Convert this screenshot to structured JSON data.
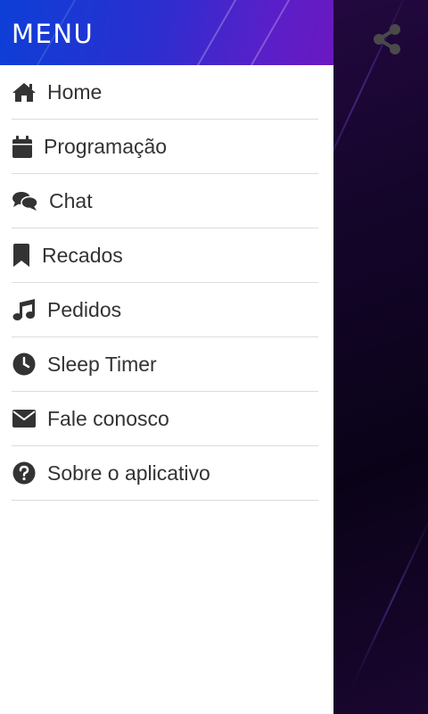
{
  "drawer": {
    "title": "MENU",
    "items": [
      {
        "label": "Home",
        "icon": "home-icon"
      },
      {
        "label": "Programação",
        "icon": "calendar-icon"
      },
      {
        "label": "Chat",
        "icon": "chat-icon"
      },
      {
        "label": "Recados",
        "icon": "bookmark-icon"
      },
      {
        "label": "Pedidos",
        "icon": "music-note-icon"
      },
      {
        "label": "Sleep Timer",
        "icon": "clock-icon"
      },
      {
        "label": "Fale conosco",
        "icon": "envelope-icon"
      },
      {
        "label": "Sobre o aplicativo",
        "icon": "question-icon"
      }
    ]
  },
  "toolbar": {
    "share_icon": "share-icon"
  },
  "colors": {
    "header_start": "#0d3fd6",
    "header_end": "#6a18c0",
    "icon": "#333333",
    "share_icon": "#4a4a4a"
  }
}
